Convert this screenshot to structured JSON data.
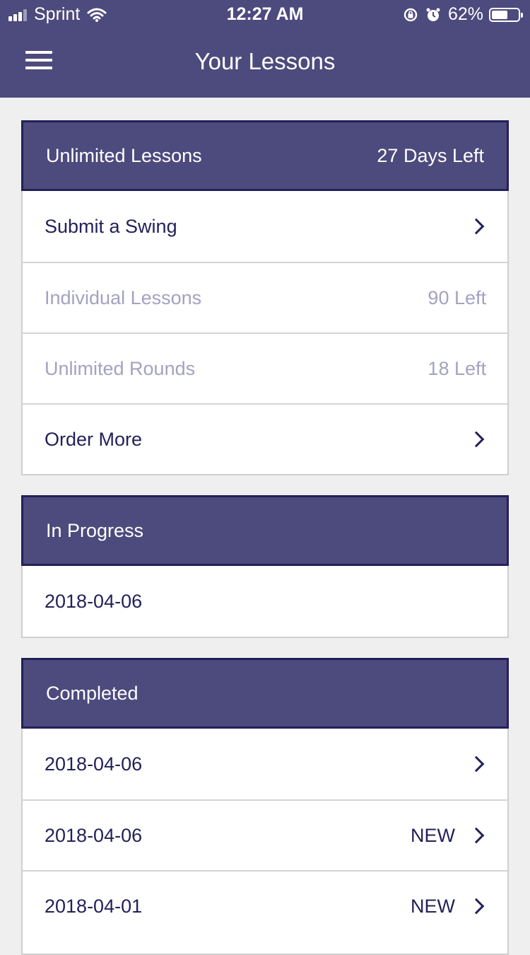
{
  "status_bar": {
    "carrier": "Sprint",
    "time": "12:27 AM",
    "battery_percent": "62%",
    "battery_level": 0.62,
    "icons": [
      "signal-icon",
      "wifi-icon",
      "rotation-lock-icon",
      "alarm-icon",
      "battery-icon"
    ]
  },
  "header": {
    "title": "Your Lessons",
    "menu_icon": "hamburger-menu-icon"
  },
  "colors": {
    "header_bg": "#4d4a7d",
    "header_border": "#23215a",
    "text_primary": "#23215a",
    "text_muted": "#a4a2c0",
    "page_bg": "#efefef"
  },
  "subscription": {
    "title": "Unlimited Lessons",
    "days_left": "27 Days Left",
    "rows": [
      {
        "label": "Submit a Swing",
        "value": "",
        "chevron": true
      },
      {
        "label": "Individual Lessons",
        "value": "90 Left"
      },
      {
        "label": "Unlimited Rounds",
        "value": "18 Left"
      },
      {
        "label": "Order More",
        "value": "",
        "chevron": true
      }
    ]
  },
  "in_progress": {
    "title": "In Progress",
    "items": [
      {
        "date": "2018-04-06"
      }
    ]
  },
  "completed": {
    "title": "Completed",
    "items": [
      {
        "date": "2018-04-06",
        "badge": ""
      },
      {
        "date": "2018-04-06",
        "badge": "NEW"
      },
      {
        "date": "2018-04-01",
        "badge": "NEW"
      }
    ]
  }
}
